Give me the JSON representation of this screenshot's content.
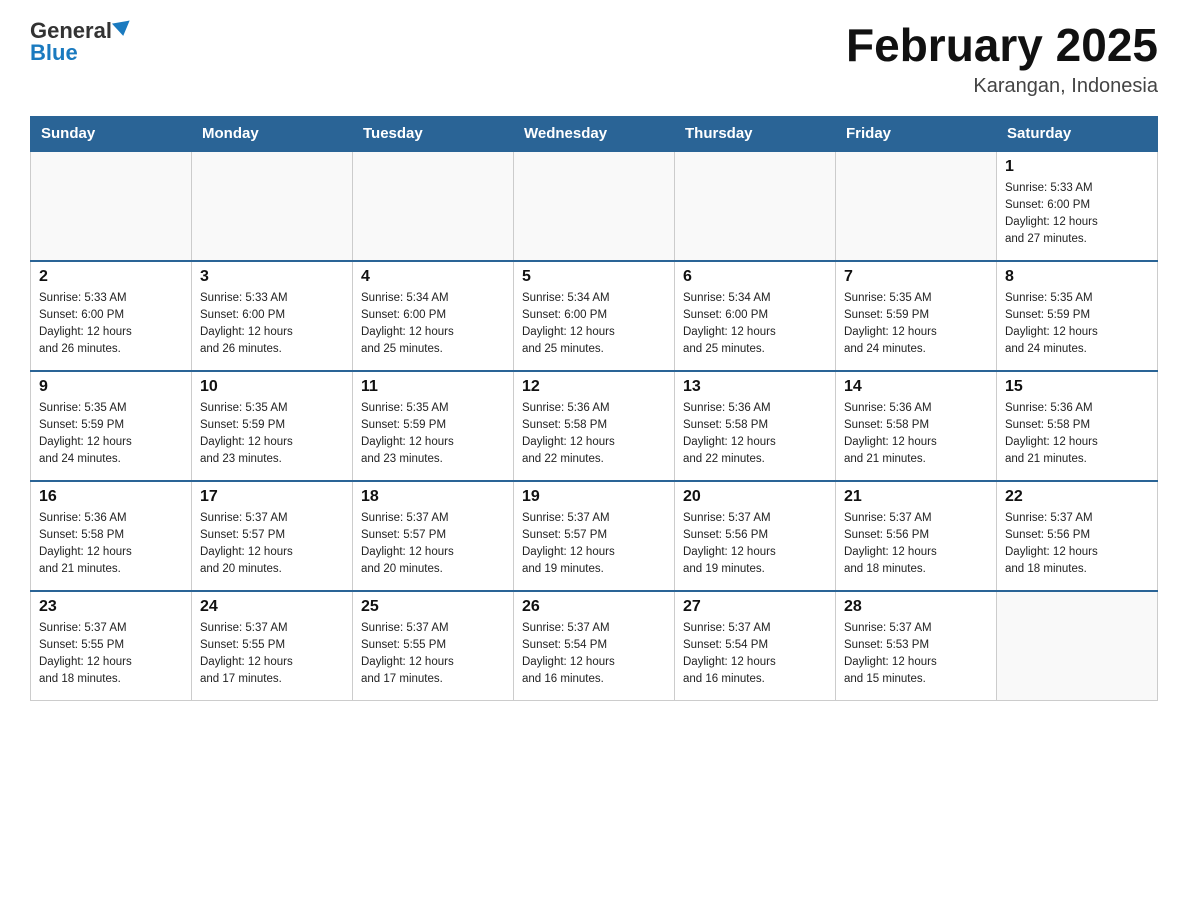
{
  "header": {
    "logo_general": "General",
    "logo_blue": "Blue",
    "month_title": "February 2025",
    "location": "Karangan, Indonesia"
  },
  "days_of_week": [
    "Sunday",
    "Monday",
    "Tuesday",
    "Wednesday",
    "Thursday",
    "Friday",
    "Saturday"
  ],
  "weeks": [
    {
      "days": [
        {
          "number": "",
          "info": ""
        },
        {
          "number": "",
          "info": ""
        },
        {
          "number": "",
          "info": ""
        },
        {
          "number": "",
          "info": ""
        },
        {
          "number": "",
          "info": ""
        },
        {
          "number": "",
          "info": ""
        },
        {
          "number": "1",
          "info": "Sunrise: 5:33 AM\nSunset: 6:00 PM\nDaylight: 12 hours\nand 27 minutes."
        }
      ]
    },
    {
      "days": [
        {
          "number": "2",
          "info": "Sunrise: 5:33 AM\nSunset: 6:00 PM\nDaylight: 12 hours\nand 26 minutes."
        },
        {
          "number": "3",
          "info": "Sunrise: 5:33 AM\nSunset: 6:00 PM\nDaylight: 12 hours\nand 26 minutes."
        },
        {
          "number": "4",
          "info": "Sunrise: 5:34 AM\nSunset: 6:00 PM\nDaylight: 12 hours\nand 25 minutes."
        },
        {
          "number": "5",
          "info": "Sunrise: 5:34 AM\nSunset: 6:00 PM\nDaylight: 12 hours\nand 25 minutes."
        },
        {
          "number": "6",
          "info": "Sunrise: 5:34 AM\nSunset: 6:00 PM\nDaylight: 12 hours\nand 25 minutes."
        },
        {
          "number": "7",
          "info": "Sunrise: 5:35 AM\nSunset: 5:59 PM\nDaylight: 12 hours\nand 24 minutes."
        },
        {
          "number": "8",
          "info": "Sunrise: 5:35 AM\nSunset: 5:59 PM\nDaylight: 12 hours\nand 24 minutes."
        }
      ]
    },
    {
      "days": [
        {
          "number": "9",
          "info": "Sunrise: 5:35 AM\nSunset: 5:59 PM\nDaylight: 12 hours\nand 24 minutes."
        },
        {
          "number": "10",
          "info": "Sunrise: 5:35 AM\nSunset: 5:59 PM\nDaylight: 12 hours\nand 23 minutes."
        },
        {
          "number": "11",
          "info": "Sunrise: 5:35 AM\nSunset: 5:59 PM\nDaylight: 12 hours\nand 23 minutes."
        },
        {
          "number": "12",
          "info": "Sunrise: 5:36 AM\nSunset: 5:58 PM\nDaylight: 12 hours\nand 22 minutes."
        },
        {
          "number": "13",
          "info": "Sunrise: 5:36 AM\nSunset: 5:58 PM\nDaylight: 12 hours\nand 22 minutes."
        },
        {
          "number": "14",
          "info": "Sunrise: 5:36 AM\nSunset: 5:58 PM\nDaylight: 12 hours\nand 21 minutes."
        },
        {
          "number": "15",
          "info": "Sunrise: 5:36 AM\nSunset: 5:58 PM\nDaylight: 12 hours\nand 21 minutes."
        }
      ]
    },
    {
      "days": [
        {
          "number": "16",
          "info": "Sunrise: 5:36 AM\nSunset: 5:58 PM\nDaylight: 12 hours\nand 21 minutes."
        },
        {
          "number": "17",
          "info": "Sunrise: 5:37 AM\nSunset: 5:57 PM\nDaylight: 12 hours\nand 20 minutes."
        },
        {
          "number": "18",
          "info": "Sunrise: 5:37 AM\nSunset: 5:57 PM\nDaylight: 12 hours\nand 20 minutes."
        },
        {
          "number": "19",
          "info": "Sunrise: 5:37 AM\nSunset: 5:57 PM\nDaylight: 12 hours\nand 19 minutes."
        },
        {
          "number": "20",
          "info": "Sunrise: 5:37 AM\nSunset: 5:56 PM\nDaylight: 12 hours\nand 19 minutes."
        },
        {
          "number": "21",
          "info": "Sunrise: 5:37 AM\nSunset: 5:56 PM\nDaylight: 12 hours\nand 18 minutes."
        },
        {
          "number": "22",
          "info": "Sunrise: 5:37 AM\nSunset: 5:56 PM\nDaylight: 12 hours\nand 18 minutes."
        }
      ]
    },
    {
      "days": [
        {
          "number": "23",
          "info": "Sunrise: 5:37 AM\nSunset: 5:55 PM\nDaylight: 12 hours\nand 18 minutes."
        },
        {
          "number": "24",
          "info": "Sunrise: 5:37 AM\nSunset: 5:55 PM\nDaylight: 12 hours\nand 17 minutes."
        },
        {
          "number": "25",
          "info": "Sunrise: 5:37 AM\nSunset: 5:55 PM\nDaylight: 12 hours\nand 17 minutes."
        },
        {
          "number": "26",
          "info": "Sunrise: 5:37 AM\nSunset: 5:54 PM\nDaylight: 12 hours\nand 16 minutes."
        },
        {
          "number": "27",
          "info": "Sunrise: 5:37 AM\nSunset: 5:54 PM\nDaylight: 12 hours\nand 16 minutes."
        },
        {
          "number": "28",
          "info": "Sunrise: 5:37 AM\nSunset: 5:53 PM\nDaylight: 12 hours\nand 15 minutes."
        },
        {
          "number": "",
          "info": ""
        }
      ]
    }
  ]
}
